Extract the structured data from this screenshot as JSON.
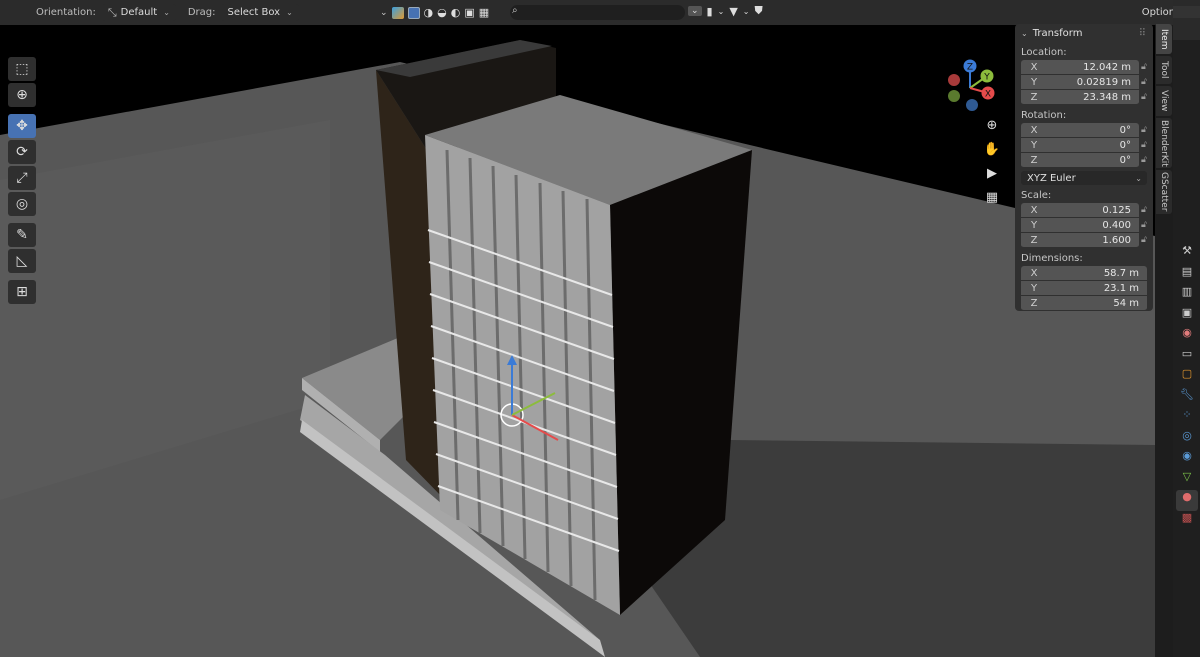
{
  "header": {
    "orientation_label": "Orientation:",
    "orientation_value": "Default",
    "drag_label": "Drag:",
    "drag_value": "Select Box",
    "options_label": "Options"
  },
  "n_panel": {
    "title": "Transform",
    "location": {
      "label": "Location:",
      "x_axis": "X",
      "x": "12.042 m",
      "y_axis": "Y",
      "y": "0.02819 m",
      "z_axis": "Z",
      "z": "23.348 m"
    },
    "rotation": {
      "label": "Rotation:",
      "x_axis": "X",
      "x": "0°",
      "y_axis": "Y",
      "y": "0°",
      "z_axis": "Z",
      "z": "0°",
      "mode": "XYZ Euler"
    },
    "scale": {
      "label": "Scale:",
      "x_axis": "X",
      "x": "0.125",
      "y_axis": "Y",
      "y": "0.400",
      "z_axis": "Z",
      "z": "1.600"
    },
    "dimensions": {
      "label": "Dimensions:",
      "x_axis": "X",
      "x": "58.7 m",
      "y_axis": "Y",
      "y": "23.1 m",
      "z_axis": "Z",
      "z": "54 m"
    }
  },
  "side_tabs": [
    "Item",
    "Tool",
    "View",
    "BlenderKit",
    "GScatter"
  ],
  "gizmo": {
    "z": "Z",
    "y": "Y",
    "x": "X"
  },
  "colors": {
    "accent": "#4772b3",
    "axis_x": "#e54b4b",
    "axis_y": "#8cbc3c",
    "axis_z": "#3b7bd6"
  }
}
